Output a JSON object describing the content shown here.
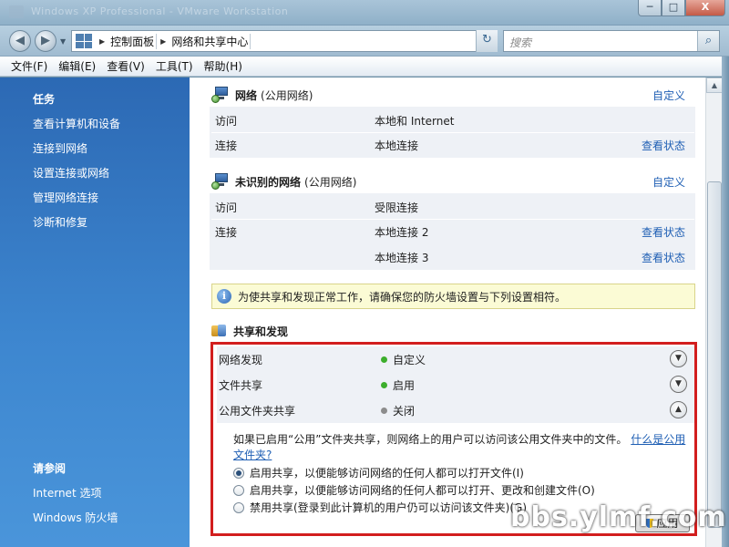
{
  "window": {
    "title": "Windows XP Professional - VMware Workstation",
    "controls": {
      "minimize": "─",
      "maximize": "□",
      "close": "X"
    }
  },
  "nav": {
    "back_icon": "back-arrow-icon",
    "forward_icon": "forward-arrow-icon",
    "breadcrumbs": [
      "控制面板",
      "网络和共享中心"
    ],
    "search_placeholder": "搜索"
  },
  "menu": [
    "文件(F)",
    "编辑(E)",
    "查看(V)",
    "工具(T)",
    "帮助(H)"
  ],
  "sidebar": {
    "tasks_heading": "任务",
    "tasks": [
      "查看计算机和设备",
      "连接到网络",
      "设置连接或网络",
      "管理网络连接",
      "诊断和修复"
    ],
    "see_also_heading": "请参阅",
    "see_also": [
      "Internet 选项",
      "Windows 防火墙"
    ]
  },
  "networks": [
    {
      "name": "网络",
      "type": "(公用网络)",
      "customize": "自定义",
      "rows": [
        {
          "label": "访问",
          "value": "本地和 Internet",
          "link": ""
        },
        {
          "label": "连接",
          "value": "本地连接",
          "link": "查看状态"
        }
      ]
    },
    {
      "name": "未识别的网络",
      "type": "(公用网络)",
      "customize": "自定义",
      "rows": [
        {
          "label": "访问",
          "value": "受限连接",
          "link": ""
        },
        {
          "label": "连接",
          "value": "本地连接 2",
          "link": "查看状态"
        },
        {
          "label": "",
          "value": "本地连接 3",
          "link": "查看状态"
        }
      ]
    }
  ],
  "info_bar": "为使共享和发现正常工作，请确保您的防火墙设置与下列设置相符。",
  "sharing": {
    "title": "共享和发现",
    "settings": [
      {
        "label": "网络发现",
        "value": "自定义",
        "status_color": "#3cae2c",
        "expanded": false
      },
      {
        "label": "文件共享",
        "value": "启用",
        "status_color": "#3cae2c",
        "expanded": false
      },
      {
        "label": "公用文件夹共享",
        "value": "关闭",
        "status_color": "#8c8c8c",
        "expanded": true
      }
    ],
    "description": "如果已启用“公用”文件夹共享，则网络上的用户可以访问该公用文件夹中的文件。",
    "description_link": "什么是公用文件夹?",
    "options": [
      {
        "label": "启用共享，以便能够访问网络的任何人都可以打开文件(I)",
        "selected": true
      },
      {
        "label": "启用共享，以便能够访问网络的任何人都可以打开、更改和创建文件(O)",
        "selected": false
      },
      {
        "label": "禁用共享(登录到此计算机的用户仍可以访问该文件夹)(G)",
        "selected": false
      }
    ],
    "apply_label": "应用"
  },
  "watermark": "bbs.ylmf.com"
}
